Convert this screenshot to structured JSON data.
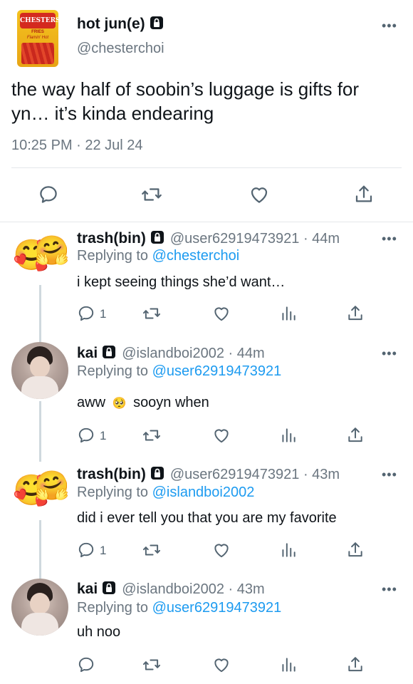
{
  "tweet": {
    "display_name": "hot jun(e)",
    "handle": "@chesterchoi",
    "text": "the way half of soobin’s luggage is gifts for yn… it’s kinda endearing",
    "timestamp": "10:25 PM · 22 Jul 24",
    "avatar_brand": "CHESTERS",
    "avatar_sub": "FRIES",
    "avatar_sub2": "Flamin' Hot"
  },
  "replies": [
    {
      "display_name": "trash(bin)",
      "handle_time": "@user62919473921 · 44m",
      "replying_label": "Replying to",
      "replying_to": "@chesterchoi",
      "text": "i kept seeing things she’d want…",
      "reply_count": "1",
      "avatar_emoji": "🥰",
      "avatar_emoji2": "🤗"
    },
    {
      "display_name": "kai",
      "handle_time": "@islandboi2002 · 44m",
      "replying_label": "Replying to",
      "replying_to": "@user62919473921",
      "text_a": "aww",
      "emoji": "🥺",
      "text_b": "sooyn when",
      "reply_count": "1"
    },
    {
      "display_name": "trash(bin)",
      "handle_time": "@user62919473921 · 43m",
      "replying_label": "Replying to",
      "replying_to": "@islandboi2002",
      "text": "did i ever tell you that you are my favorite",
      "reply_count": "1",
      "avatar_emoji": "🥰",
      "avatar_emoji2": "🤗"
    },
    {
      "display_name": "kai",
      "handle_time": "@islandboi2002 · 43m",
      "replying_label": "Replying to",
      "replying_to": "@user62919473921",
      "text": "uh noo"
    }
  ],
  "icons": {
    "more": "more-icon",
    "reply": "reply-icon",
    "retweet": "retweet-icon",
    "like": "like-icon",
    "stats": "stats-icon",
    "share": "share-icon",
    "lock": "lock-icon"
  },
  "colors": {
    "link": "#1d9bf0",
    "muted": "#6b7680",
    "text": "#0f1419",
    "divider": "#e4e7ea"
  }
}
